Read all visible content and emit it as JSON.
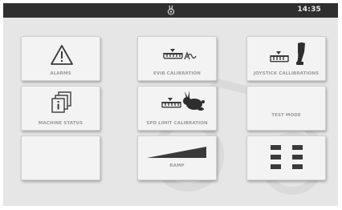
{
  "statusbar": {
    "time": "14:35",
    "logo_icon": "bunny-logo-icon"
  },
  "tiles": [
    {
      "id": "alarms",
      "label": "ALARMS",
      "icon": "warning-triangle-icon"
    },
    {
      "id": "evib",
      "label": "EVIB CALIBRATION",
      "icon": "vibration-calibration-icon"
    },
    {
      "id": "joystick",
      "label": "JOYSTICK CALLIBRATIONS",
      "icon": "joystick-calibration-icon"
    },
    {
      "id": "machine-status",
      "label": "MACHINE STATUS",
      "icon": "info-pages-icon"
    },
    {
      "id": "spd-limit",
      "label": "SPD LIMIT CALIBRATION",
      "icon": "rabbit-speed-icon"
    },
    {
      "id": "test-mode",
      "label": "TEST MODE",
      "icon": ""
    },
    {
      "id": "blank",
      "label": "",
      "icon": ""
    },
    {
      "id": "ramp",
      "label": "RAMP",
      "icon": "ramp-wedge-icon"
    },
    {
      "id": "menu",
      "label": "",
      "icon": "grid-menu-icon"
    }
  ],
  "colors": {
    "statusbar": "#2f2f2f",
    "background": "#e6e6e6",
    "tile": "#f3f3f3",
    "icon": "#3a3a3a",
    "label": "#9a9a9a"
  }
}
